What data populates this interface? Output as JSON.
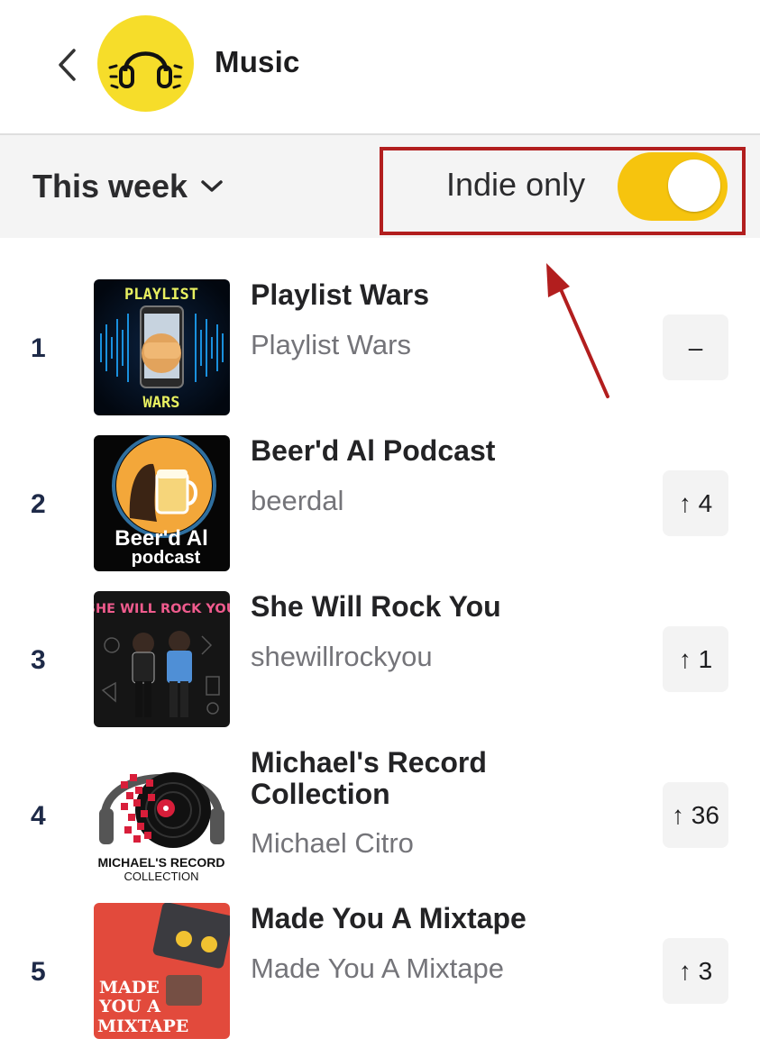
{
  "header": {
    "title": "Music",
    "category_icon": "headphones-icon",
    "back_icon": "chevron-left-icon",
    "accent_color": "#f6dd2a"
  },
  "filters": {
    "period_label": "This week",
    "period_icon": "chevron-down-icon",
    "indie_label": "Indie only",
    "indie_toggle_on": true,
    "toggle_color": "#f6c40e"
  },
  "annotation": {
    "highlight_color": "#b21e1e"
  },
  "chart": [
    {
      "rank": "1",
      "title": "Playlist Wars",
      "author": "Playlist Wars",
      "change": "–",
      "art_text_top": "PLAYLIST",
      "art_text_bottom": "WARS"
    },
    {
      "rank": "2",
      "title": "Beer'd Al Podcast",
      "author": "beerdal",
      "change": "↑ 4",
      "art_text_top": "Beer'd Al",
      "art_text_bottom": "podcast"
    },
    {
      "rank": "3",
      "title": "She Will Rock You",
      "author": "shewillrockyou",
      "change": "↑ 1",
      "art_text_top": "SHE WILL ROCK YOU"
    },
    {
      "rank": "4",
      "title_line1": "Michael's Record",
      "title_line2": "Collection",
      "author": "Michael Citro",
      "change": "↑ 36",
      "art_text_top": "MICHAEL'S RECORD",
      "art_text_bottom": "COLLECTION"
    },
    {
      "rank": "5",
      "title": "Made You A Mixtape",
      "author": "Made You A Mixtape",
      "change": "↑ 3",
      "art_line1": "MADE",
      "art_line2": "YOU A",
      "art_line3": "MIXTAPE"
    }
  ]
}
